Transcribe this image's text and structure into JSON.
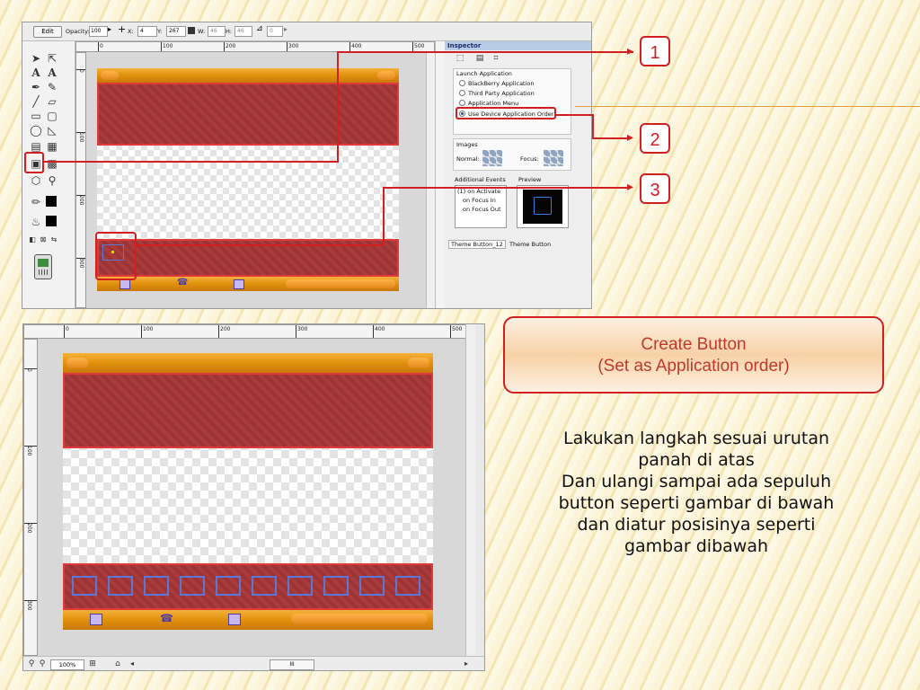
{
  "toolbar": {
    "edit_label": "Edit",
    "opacity_label": "Opacity:",
    "opacity_value": "100",
    "x_label": "X:",
    "x_value": "4",
    "y_label": "Y:",
    "y_value": "267",
    "w_label": "W:",
    "w_value": "46",
    "h_label": "H:",
    "h_value": "46",
    "angle_value": "0"
  },
  "ruler_top_labels": [
    "0",
    "100",
    "200",
    "300",
    "400",
    "500"
  ],
  "ruler_left_labels": [
    "0",
    "100",
    "200",
    "300"
  ],
  "inspector": {
    "title": "Inspector",
    "group_title": "Launch Application",
    "options": [
      "BlackBerry Application",
      "Third Party Application",
      "Application Menu",
      "Use Device Application Order"
    ],
    "selected_option": "Use Device Application Order",
    "images_label": "Images",
    "normal_label": "Normal:",
    "focus_label": "Focus:",
    "additional_events_label": "Additional Events",
    "preview_label": "Preview",
    "events": [
      "(1) on Activate",
      "on Focus In",
      "on Focus Out"
    ],
    "theme_name": "Theme Button_12",
    "theme_type": "Theme Button"
  },
  "callouts": [
    "1",
    "2",
    "3"
  ],
  "bottom_status": {
    "zoom": "100%",
    "scroll_label": "III"
  },
  "info_box": {
    "line1": "Create Button",
    "line2": "(Set as Application order)"
  },
  "instructions": [
    "Lakukan langkah sesuai urutan",
    "panah di atas",
    "Dan ulangi sampai ada sepuluh",
    "button seperti gambar di bawah",
    "dan diatur posisinya seperti",
    "gambar dibawah"
  ],
  "colors": {
    "accent_red": "#d21f1f",
    "panel_red": "#a93b3d",
    "orange_bar": "#e0900c",
    "info_text": "#c0392b"
  }
}
